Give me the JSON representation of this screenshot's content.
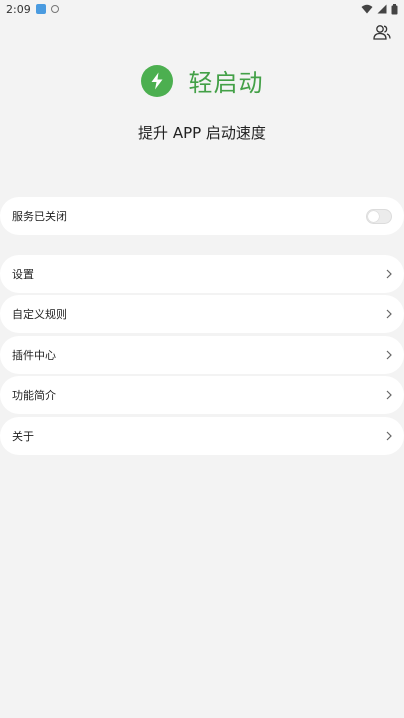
{
  "status_bar": {
    "time": "2:09",
    "icons": [
      "notification-app-icon",
      "notification-dot-icon",
      "wifi-icon",
      "cell-signal-icon",
      "battery-icon"
    ]
  },
  "header": {
    "account_icon": "users-icon"
  },
  "brand": {
    "name": "轻启动",
    "logo_icon": "lightning-bolt-icon",
    "accent_color": "#43a047"
  },
  "tagline": "提升 APP 启动速度",
  "service": {
    "label": "服务已关闭",
    "enabled": false
  },
  "menu": {
    "items": [
      {
        "label": "设置"
      },
      {
        "label": "自定义规则"
      },
      {
        "label": "插件中心"
      },
      {
        "label": "功能简介"
      },
      {
        "label": "关于"
      }
    ]
  }
}
